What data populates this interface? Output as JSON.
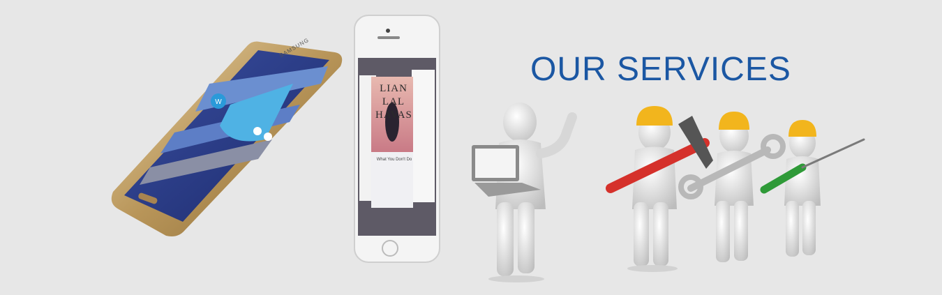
{
  "banner": {
    "heading": "OUR SERVICES"
  },
  "phone_left": {
    "brand_text": "SAMSUNG",
    "badge_letter": "W"
  },
  "phone_right": {
    "album_text": "LIAN LAL HAVAS",
    "now_playing": "What You Don't Do"
  },
  "colors": {
    "heading": "#1b57a3",
    "background": "#e7e7e7",
    "hard_hat": "#f2b51d",
    "hammer_red": "#d5312b",
    "screwdriver_green": "#2f9a38"
  },
  "icons": [
    "smartphone-icon",
    "iphone-icon",
    "laptop-icon",
    "worker-figure-icon",
    "hammer-icon",
    "wrench-icon",
    "screwdriver-icon",
    "hard-hat-icon"
  ]
}
